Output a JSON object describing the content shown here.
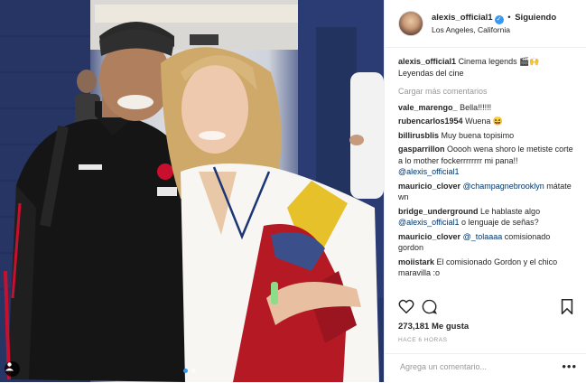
{
  "post": {
    "username": "alexis_official1",
    "verified": true,
    "separator": "•",
    "follow_label": "Siguiendo",
    "location": "Los Angeles, California",
    "caption": {
      "user": "alexis_official1",
      "text": "Cinema legends 🎬🙌 Leyendas del cine"
    },
    "load_more": "Cargar más comentarios",
    "likes": "273,181 Me gusta",
    "time": "HACE 6 HORAS",
    "comment_placeholder": "Agrega un comentario...",
    "more_label": "•••"
  },
  "comments": [
    {
      "user": "vale_marengo_",
      "text": "Bella!!!!!!",
      "mention": ""
    },
    {
      "user": "rubencarlos1954",
      "text": "Wuena 😆",
      "mention": ""
    },
    {
      "user": "billirusblis",
      "text": "Muy buena topisimo",
      "mention": ""
    },
    {
      "user": "gasparrillon",
      "text": "Ooooh wena shoro le metiste corte a lo mother fockerrrrrrrr mi pana!! ",
      "mention": "@alexis_official1"
    },
    {
      "user": "mauricio_clover",
      "text": " mátate wn",
      "mention": "@champagnebrooklyn",
      "mention_first": true
    },
    {
      "user": "bridge_underground",
      "text": "Le hablaste algo ",
      "mention": "@alexis_official1",
      "tail": " o lenguaje de señas?"
    },
    {
      "user": "mauricio_clover",
      "text": " comisionado gordon",
      "mention": "@_tolaaaa",
      "mention_first": true
    },
    {
      "user": "moiistark",
      "text": "El comisionado Gordon y el chico maravilla :o",
      "mention": ""
    }
  ],
  "icons": {
    "like": "heart-icon",
    "comment": "comment-icon",
    "save": "bookmark-icon",
    "tag": "user-tag-icon"
  },
  "carousel": {
    "count": 2,
    "active_index": 0
  },
  "colors": {
    "link": "#003569",
    "muted": "#999999",
    "verified": "#3897f0",
    "text": "#262626"
  }
}
